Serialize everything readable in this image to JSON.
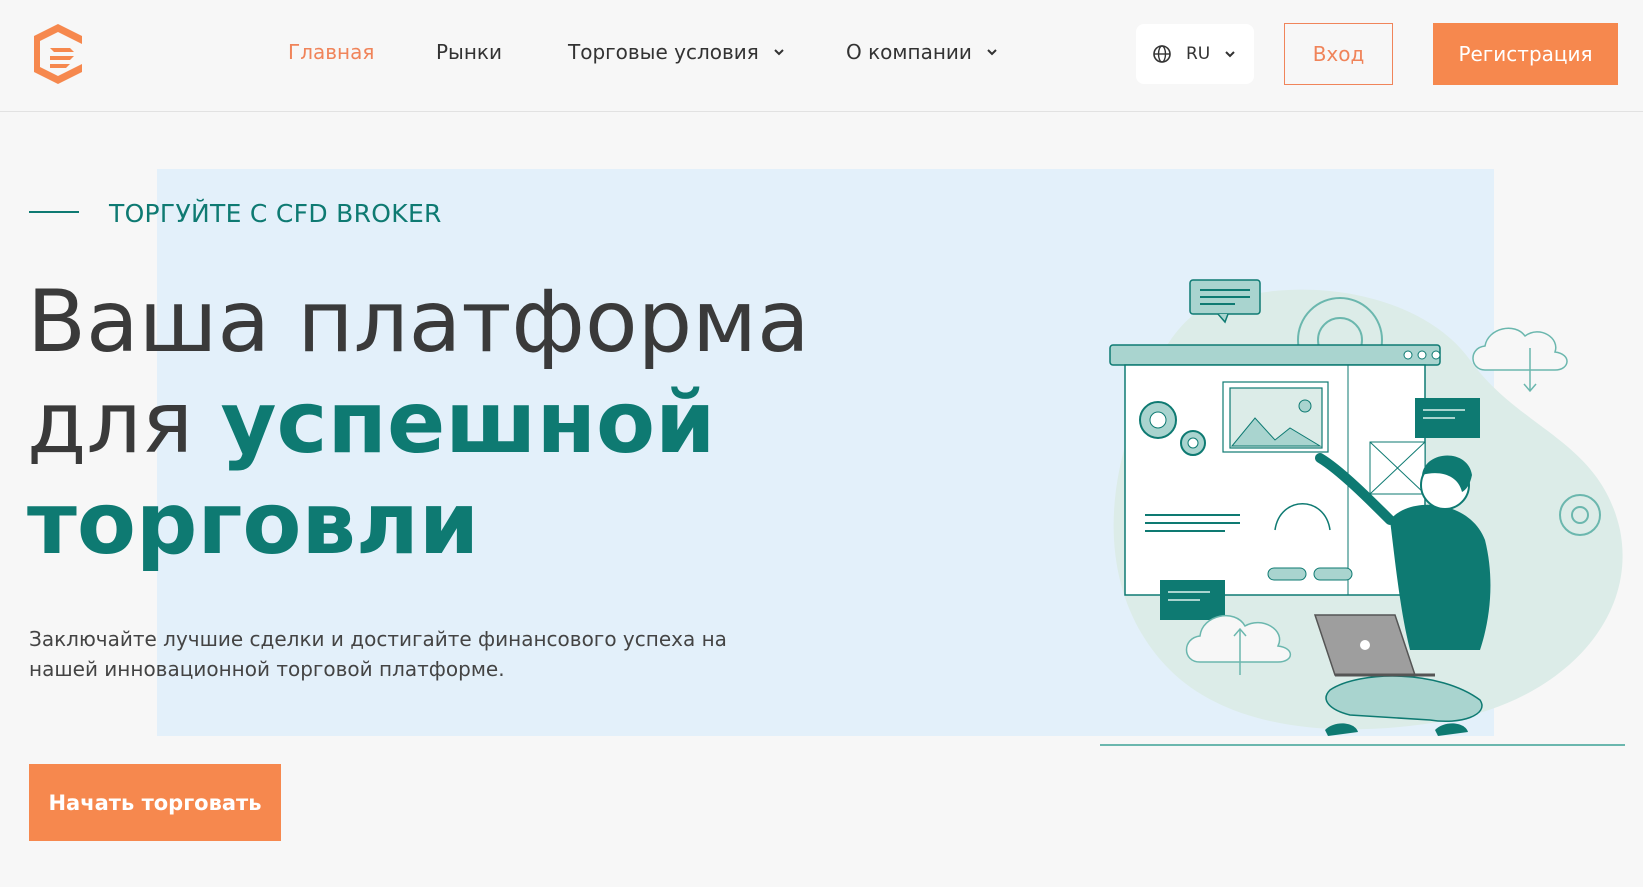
{
  "header": {
    "nav": [
      {
        "label": "Главная",
        "active": true
      },
      {
        "label": "Рынки",
        "active": false
      },
      {
        "label": "Торговые условия",
        "active": false,
        "dropdown": true
      },
      {
        "label": "О компании",
        "active": false,
        "dropdown": true
      }
    ],
    "language": {
      "value": "RU",
      "icon": "globe-icon"
    },
    "login_label": "Вход",
    "register_label": "Регистрация"
  },
  "hero": {
    "eyebrow": "ТОРГУЙТЕ С CFD BROKER",
    "title_line1": "Ваша платформа",
    "title_line2_plain": "для ",
    "title_line2_accent": "успешной",
    "title_line3_accent": "торговли",
    "subtitle": "Заключайте лучшие сделки и достигайте финансового успеха на нашей инновационной торговой платформе.",
    "cta_label": "Начать торговать"
  },
  "colors": {
    "accent_orange": "#f6884e",
    "accent_teal": "#0e7a72",
    "hero_bg": "#e3f0fa",
    "page_bg": "#f7f7f7"
  }
}
